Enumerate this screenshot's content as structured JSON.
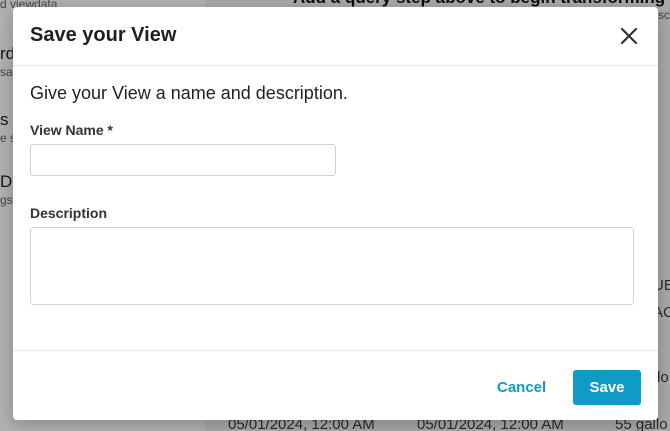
{
  "background": {
    "sidebar": [
      {
        "title": "",
        "subtitle": "d viewdata"
      },
      {
        "title": "rd",
        "subtitle": "sa"
      },
      {
        "title": "s",
        "subtitle": "e s"
      },
      {
        "title": "De",
        "subtitle": "gs,"
      }
    ],
    "main": {
      "hint": "Add a query step above to begin transforming yo",
      "hint_sub": "sc",
      "cells": [
        "UE",
        "AC",
        "lo",
        "05/01/2024, 12:00 AM",
        "05/01/2024, 12:00 AM",
        "55 gallo"
      ]
    }
  },
  "modal": {
    "title": "Save your View",
    "intro": "Give your View a name and description.",
    "name_label": "View Name *",
    "name_value": "",
    "description_label": "Description",
    "description_value": "",
    "cancel_label": "Cancel",
    "save_label": "Save",
    "accent_color": "#0e9bc6"
  }
}
